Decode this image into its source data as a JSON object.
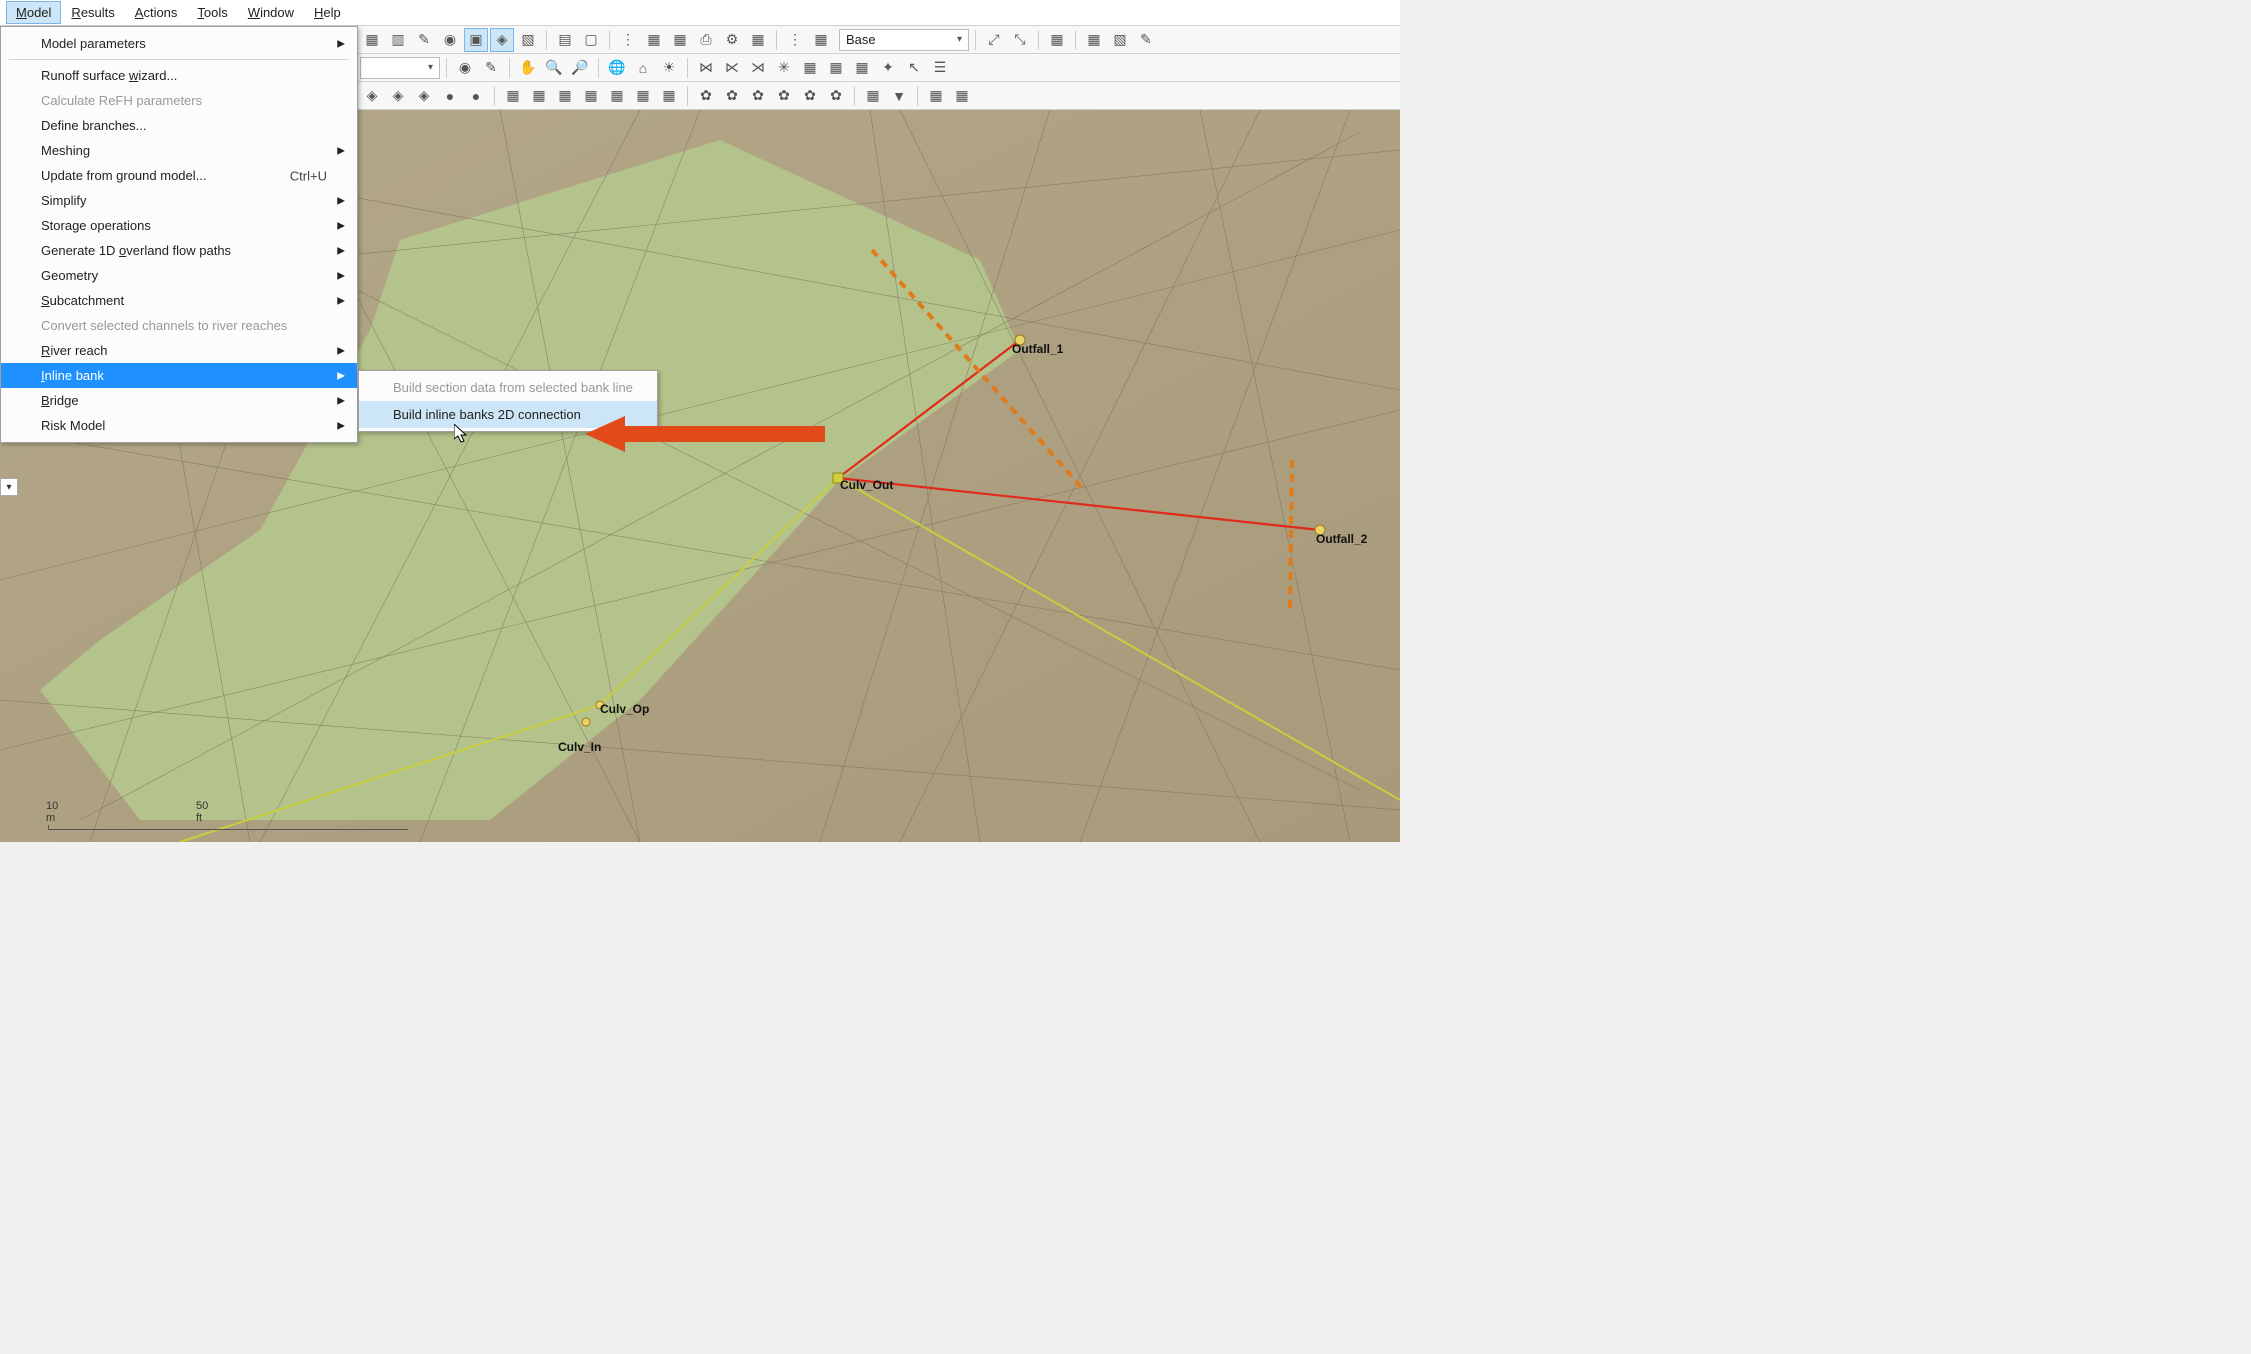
{
  "menubar": {
    "items": [
      {
        "label": "Model",
        "accelerator": "M",
        "active": true
      },
      {
        "label": "Results",
        "accelerator": "R"
      },
      {
        "label": "Actions",
        "accelerator": "A"
      },
      {
        "label": "Tools",
        "accelerator": "T"
      },
      {
        "label": "Window",
        "accelerator": "W"
      },
      {
        "label": "Help",
        "accelerator": "H"
      }
    ]
  },
  "dropdown": {
    "items": [
      {
        "label": "Model parameters",
        "submenu": true
      },
      {
        "sep": true
      },
      {
        "label": "Runoff surface wizard..."
      },
      {
        "label": "Calculate ReFH parameters",
        "disabled": true
      },
      {
        "label": "Define branches..."
      },
      {
        "label": "Meshing",
        "submenu": true
      },
      {
        "label": "Update from ground model...",
        "shortcut": "Ctrl+U"
      },
      {
        "label": "Simplify",
        "submenu": true
      },
      {
        "label": "Storage operations",
        "submenu": true
      },
      {
        "label": "Generate 1D overland flow paths",
        "submenu": true
      },
      {
        "label": "Geometry",
        "submenu": true
      },
      {
        "label": "Subcatchment",
        "submenu": true
      },
      {
        "label": "Convert selected channels to river reaches",
        "disabled": true
      },
      {
        "label": "River reach",
        "submenu": true
      },
      {
        "label": "Inline bank",
        "submenu": true,
        "highlight": true
      },
      {
        "label": "Bridge",
        "submenu": true
      },
      {
        "label": "Risk Model",
        "submenu": true
      }
    ]
  },
  "submenu_inlinebank": {
    "items": [
      {
        "label": "Build section data from selected bank line",
        "disabled": true
      },
      {
        "label": "Build inline banks 2D connection",
        "highlight": true
      }
    ]
  },
  "toolbar_combo": {
    "value": "Base"
  },
  "viewport_labels": {
    "outfall1": "Outfall_1",
    "outfall2": "Outfall_2",
    "culv_out": "Culv_Out",
    "culv_op": "Culv_Op",
    "culv_in": "Culv_In"
  },
  "scale": {
    "left": "10 m",
    "right": "50 ft"
  }
}
